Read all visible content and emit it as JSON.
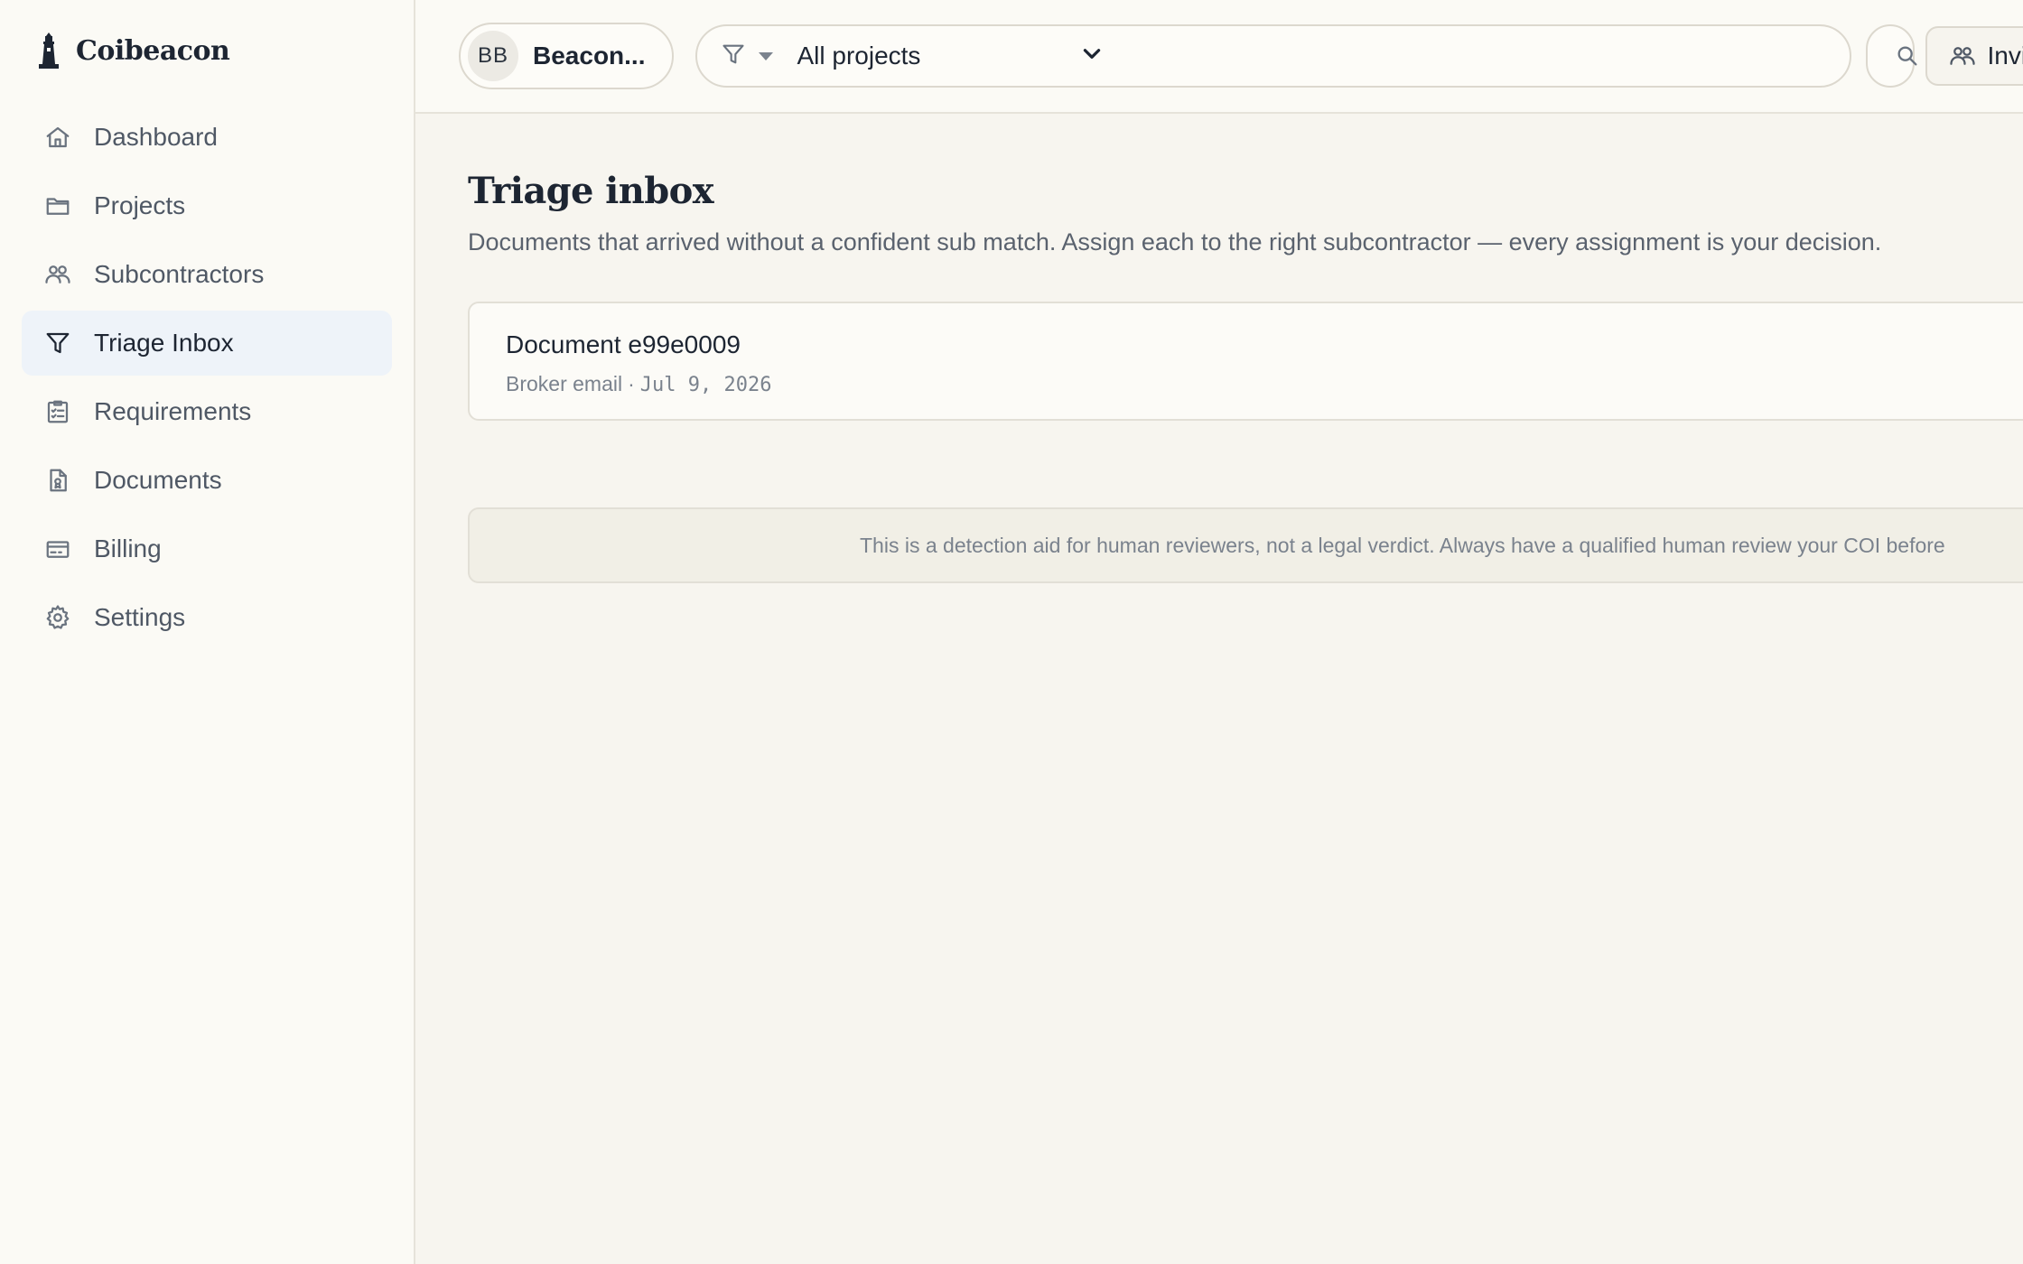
{
  "brand": {
    "name": "Coibeacon",
    "logo_icon": "lighthouse-icon"
  },
  "sidebar": {
    "items": [
      {
        "label": "Dashboard",
        "icon": "home-icon",
        "active": false
      },
      {
        "label": "Projects",
        "icon": "folder-icon",
        "active": false
      },
      {
        "label": "Subcontractors",
        "icon": "users-icon",
        "active": false
      },
      {
        "label": "Triage Inbox",
        "icon": "filter-icon",
        "active": true
      },
      {
        "label": "Requirements",
        "icon": "clipboard-list-icon",
        "active": false
      },
      {
        "label": "Documents",
        "icon": "document-icon",
        "active": false
      },
      {
        "label": "Billing",
        "icon": "credit-card-icon",
        "active": false
      },
      {
        "label": "Settings",
        "icon": "gear-icon",
        "active": false
      }
    ]
  },
  "topbar": {
    "org": {
      "initials": "BB",
      "name": "Beacon..."
    },
    "project_filter": {
      "selected": "All projects"
    },
    "invite_label": "Invit"
  },
  "page": {
    "title": "Triage inbox",
    "subtitle": "Documents that arrived without a confident sub match. Assign each to the right subcontractor — every assignment is your decision."
  },
  "documents": [
    {
      "title": "Document e99e0009",
      "source": "Broker email",
      "separator": "·",
      "date": "Jul 9, 2026"
    }
  ],
  "disclaimer": "This is a detection aid for human reviewers, not a legal verdict. Always have a qualified human review your COI before"
}
